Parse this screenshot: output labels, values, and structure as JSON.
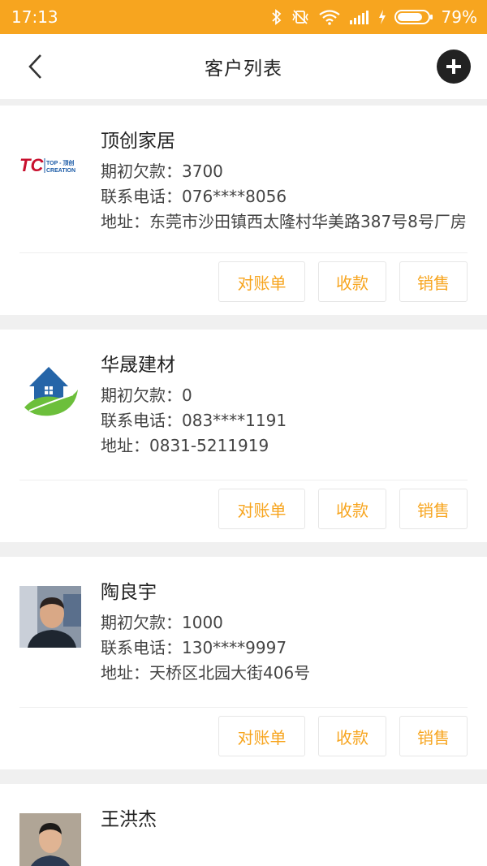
{
  "status_bar": {
    "time": "17:13",
    "battery": "79%",
    "icons": [
      "bluetooth-icon",
      "vibrate-icon",
      "wifi-icon",
      "signal-icon",
      "charging-icon",
      "battery-icon"
    ]
  },
  "nav": {
    "title": "客户列表",
    "back_icon": "chevron-left-icon",
    "add_icon": "plus-circle-icon"
  },
  "labels": {
    "balance": "期初欠款：",
    "phone": "联系电话：",
    "address": "地址："
  },
  "customers": [
    {
      "name": "顶创家居",
      "balance": "3700",
      "phone": "076****8056",
      "address": "东莞市沙田镇西太隆村华美路387号8号厂房",
      "avatar": "tc-logo",
      "logo_text": "TC",
      "logo_sub1": "TOP - 顶创",
      "logo_sub2": "CREATION"
    },
    {
      "name": "华晟建材",
      "balance": "0",
      "phone": "083****1191",
      "address": "0831-5211919",
      "avatar": "house-leaf-logo"
    },
    {
      "name": "陶良宇",
      "balance": "1000",
      "phone": "130****9997",
      "address": "天桥区北园大街406号",
      "avatar": "person-photo"
    },
    {
      "name": "王洪杰",
      "avatar": "person-photo"
    }
  ],
  "actions": {
    "statement": "对账单",
    "collect": "收款",
    "sale": "销售"
  },
  "colors": {
    "accent": "#f7a51f",
    "background": "#f0f0f0"
  }
}
